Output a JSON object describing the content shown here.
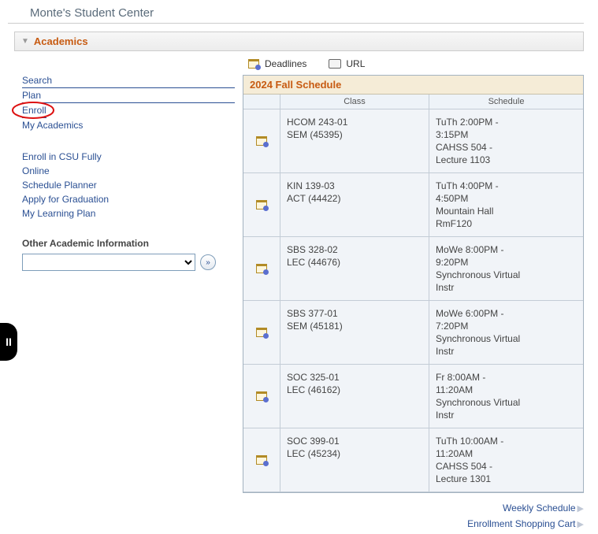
{
  "pageTitle": "Monte's Student Center",
  "section": "Academics",
  "leftNav": {
    "group1": [
      {
        "label": "Search"
      },
      {
        "label": "Plan"
      },
      {
        "label": "Enroll",
        "circled": true
      },
      {
        "label": "My Academics"
      }
    ],
    "group2": [
      {
        "label": "Enroll in CSU Fully Online"
      },
      {
        "label": "Schedule Planner"
      },
      {
        "label": "Apply for Graduation"
      },
      {
        "label": "My Learning Plan"
      }
    ],
    "otherLabel": "Other Academic Information"
  },
  "tabs": {
    "deadlines": "Deadlines",
    "url": "URL"
  },
  "schedule": {
    "title": "2024 Fall Schedule",
    "head": {
      "class": "Class",
      "schedule": "Schedule"
    },
    "rows": [
      {
        "class_line1": "HCOM 243-01",
        "class_line2": "SEM (45395)",
        "sched_line1": "TuTh 2:00PM -",
        "sched_line2": "3:15PM",
        "sched_line3": "CAHSS 504 -",
        "sched_line4": "Lecture 1103"
      },
      {
        "class_line1": "KIN 139-03",
        "class_line2": "ACT (44422)",
        "sched_line1": "TuTh 4:00PM -",
        "sched_line2": "4:50PM",
        "sched_line3": "Mountain Hall",
        "sched_line4": "RmF120"
      },
      {
        "class_line1": "SBS 328-02",
        "class_line2": "LEC (44676)",
        "sched_line1": "MoWe 8:00PM -",
        "sched_line2": "9:20PM",
        "sched_line3": "Synchronous Virtual",
        "sched_line4": "Instr"
      },
      {
        "class_line1": "SBS 377-01",
        "class_line2": "SEM (45181)",
        "sched_line1": "MoWe 6:00PM -",
        "sched_line2": "7:20PM",
        "sched_line3": "Synchronous Virtual",
        "sched_line4": "Instr"
      },
      {
        "class_line1": "SOC 325-01",
        "class_line2": "LEC (46162)",
        "sched_line1": "Fr 8:00AM -",
        "sched_line2": "11:20AM",
        "sched_line3": "Synchronous Virtual",
        "sched_line4": "Instr"
      },
      {
        "class_line1": "SOC 399-01",
        "class_line2": "LEC (45234)",
        "sched_line1": "TuTh 10:00AM -",
        "sched_line2": "11:20AM",
        "sched_line3": "CAHSS 504 -",
        "sched_line4": "Lecture 1301"
      }
    ]
  },
  "bottomLinks": {
    "weekly": "Weekly Schedule",
    "cart": "Enrollment Shopping Cart"
  },
  "pause": "II"
}
